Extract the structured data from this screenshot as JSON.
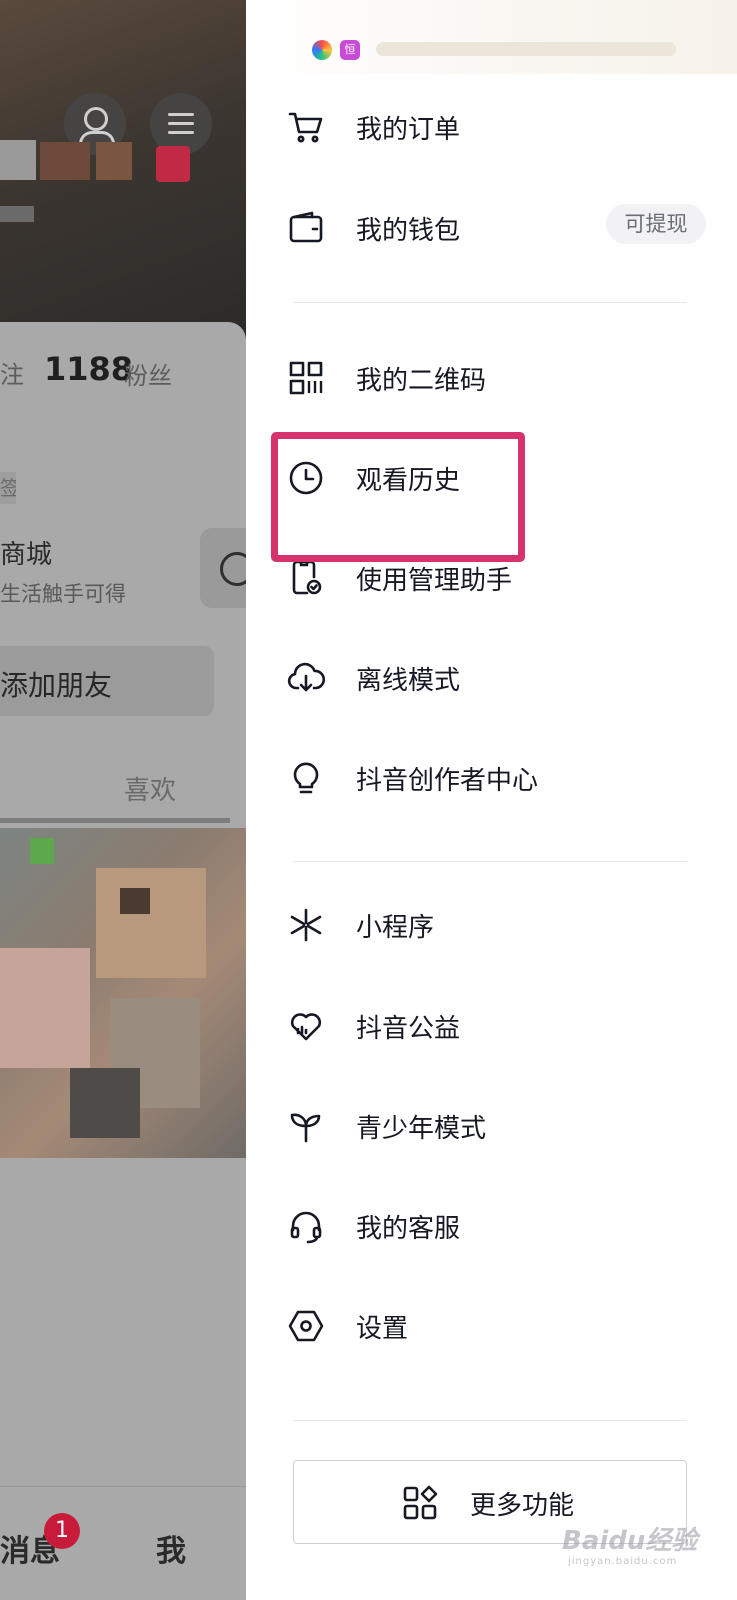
{
  "status_bar": {
    "app_icon_label": "恒长"
  },
  "background_profile": {
    "follow_label_tail": "注",
    "fans_count": "1188",
    "fans_label": "粉丝",
    "tag_tail": "签",
    "shop_title": "商城",
    "shop_subtitle": "生活触手可得",
    "add_friend_label": "添加朋友",
    "like_tab": "喜欢",
    "bottom_nav": {
      "messages_label": "消息",
      "messages_badge": "1",
      "me_label": "我"
    }
  },
  "drawer": {
    "group1": [
      {
        "label": "我的订单",
        "icon": "shopping-cart-icon"
      },
      {
        "label": "我的钱包",
        "icon": "wallet-icon",
        "pill": "可提现"
      }
    ],
    "group2": [
      {
        "label": "我的二维码",
        "icon": "qr-code-icon"
      },
      {
        "label": "观看历史",
        "icon": "clock-icon"
      },
      {
        "label": "使用管理助手",
        "icon": "phone-check-icon"
      },
      {
        "label": "离线模式",
        "icon": "cloud-download-icon"
      },
      {
        "label": "抖音创作者中心",
        "icon": "lightbulb-icon"
      }
    ],
    "group3": [
      {
        "label": "小程序",
        "icon": "sparkle-icon"
      },
      {
        "label": "抖音公益",
        "icon": "heart-icon"
      },
      {
        "label": "青少年模式",
        "icon": "sprout-icon"
      },
      {
        "label": "我的客服",
        "icon": "headset-icon"
      },
      {
        "label": "设置",
        "icon": "hexagon-settings-icon"
      }
    ],
    "more_button_label": "更多功能"
  },
  "highlighted_item": "观看历史",
  "highlight_color": "#d6336c",
  "watermark": {
    "text": "Baidu经验",
    "sub": "jingyan.baidu.com"
  }
}
